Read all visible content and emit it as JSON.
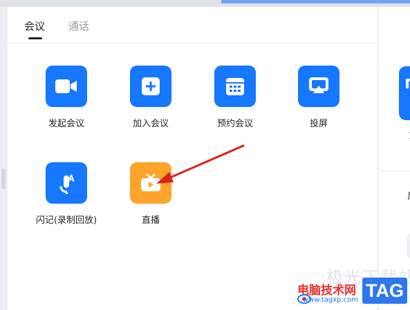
{
  "tabs": [
    {
      "label": "会议",
      "active": true
    },
    {
      "label": "通话",
      "active": false
    }
  ],
  "tiles": [
    {
      "label": "发起会议",
      "icon": "video-camera-icon",
      "color": "#1677ff"
    },
    {
      "label": "加入会议",
      "icon": "plus-square-icon",
      "color": "#1677ff"
    },
    {
      "label": "预约会议",
      "icon": "calendar-icon",
      "color": "#1677ff"
    },
    {
      "label": "投屏",
      "icon": "screen-cast-icon",
      "color": "#1677ff"
    },
    {
      "label": "闪记(录制回放)",
      "icon": "microphone-text-icon",
      "color": "#1677ff"
    },
    {
      "label": "直播",
      "icon": "tv-live-icon",
      "color": "#ffa42b"
    }
  ],
  "right_panel": {
    "text_1": "1",
    "text_2": "反"
  },
  "watermark": {
    "faded_text": "极光下载站",
    "brand_text": "电脑技术网",
    "url_text": "www.tagxp.com",
    "badge_text": "TAG"
  },
  "colors": {
    "primary_blue": "#1677ff",
    "live_orange": "#ffa42b",
    "annotation_red": "#d9211e"
  }
}
